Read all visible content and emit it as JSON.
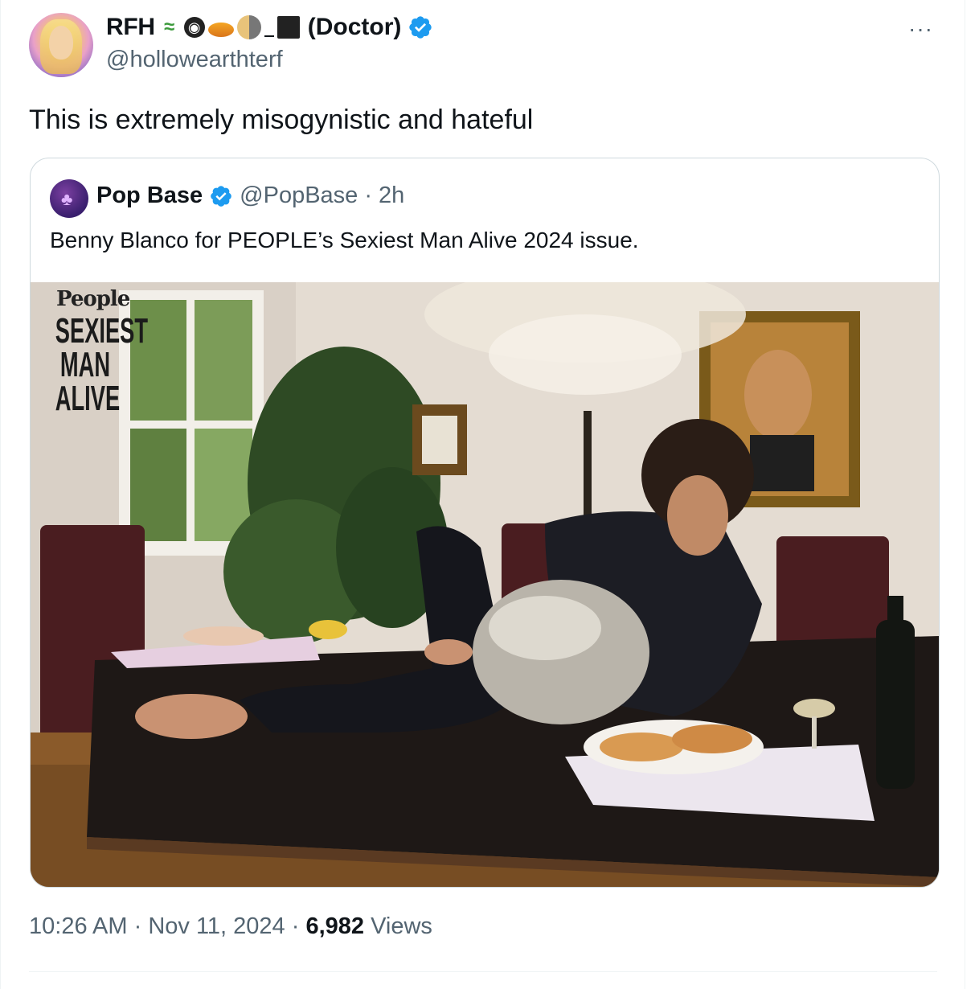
{
  "tweet": {
    "author": {
      "display_name": "RFH",
      "name_emojis": [
        "lizard",
        "magnifier-eye",
        "ringed-planet",
        "last-quarter-moon",
        "underscore",
        "black-square"
      ],
      "name_suffix": "(Doctor)",
      "handle": "@hollowearthterf",
      "verified": true
    },
    "more_icon": "···",
    "text": "This is extremely misogynistic and hateful",
    "quoted": {
      "author": {
        "display_name": "Pop Base",
        "handle": "@PopBase",
        "verified": true
      },
      "time": "· 2h",
      "text": "Benny Blanco for PEOPLE’s Sexiest Man Alive 2024 issue.",
      "image": {
        "masthead": "People",
        "cover_lines": [
          "SEXIEST",
          "MAN",
          "ALIVE"
        ]
      }
    },
    "meta": {
      "time": "10:26 AM",
      "sep1": " · ",
      "date": "Nov 11, 2024",
      "sep2": " · ",
      "views_count": "6,982",
      "views_label": " Views"
    }
  },
  "colors": {
    "verified_blue": "#1d9bf0",
    "secondary_text": "#536471",
    "border": "#cfd9de"
  }
}
